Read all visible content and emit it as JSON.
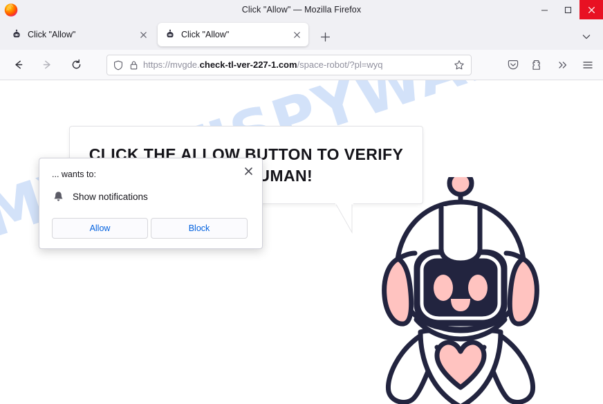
{
  "window": {
    "title": "Click \"Allow\" — Mozilla Firefox",
    "minimize_label": "Minimize",
    "maximize_label": "Maximize",
    "close_label": "Close"
  },
  "tabs": [
    {
      "title": "Click \"Allow\"",
      "favicon": "robot-favicon",
      "close_label": "Close tab",
      "active": false
    },
    {
      "title": "Click \"Allow\"",
      "favicon": "robot-favicon",
      "close_label": "Close tab",
      "active": true
    }
  ],
  "tabstrip": {
    "new_tab_label": "Open a new tab",
    "list_all_tabs_label": "List all tabs"
  },
  "navigation": {
    "back_label": "Go back one page",
    "forward_label": "Go forward one page",
    "reload_label": "Reload current page"
  },
  "urlbar": {
    "shield_icon": "shield-icon",
    "lock_icon": "padlock-icon",
    "url_prefix": "https://mvgde.",
    "url_domain": "check-tl-ver-227-1.com",
    "url_path": "/space-robot/?pl=wyq",
    "full_url": "https://mvgde.check-tl-ver-227-1.com/space-robot/?pl=wyq",
    "bookmark_label": "Bookmark this page"
  },
  "toolbar_right": {
    "pocket_label": "Save to Pocket",
    "extensions_label": "Extensions",
    "overflow_label": "More tools",
    "menu_label": "Open application menu"
  },
  "permission_popup": {
    "host_text": "... wants to:",
    "permission_label": "Show notifications",
    "bell_icon": "bell-icon",
    "close_icon": "close-icon",
    "allow_label": "Allow",
    "block_label": "Block"
  },
  "page": {
    "watermark": "MYANTISPYWARE.COM",
    "bubble_line_1": "CLICK THE ALLOW BUTTON TO VERIFY",
    "bubble_line_2": "YOU'RE HUMAN!",
    "robot_alt": "space robot mascot"
  },
  "colors": {
    "chrome_bg": "#f0f0f4",
    "navbar_bg": "#f9f9fb",
    "close_btn": "#e81123",
    "link_blue": "#0060df",
    "watermark_blue": "#ccddf8",
    "robot_outline": "#22243f",
    "robot_pink": "#ffc3c0"
  }
}
